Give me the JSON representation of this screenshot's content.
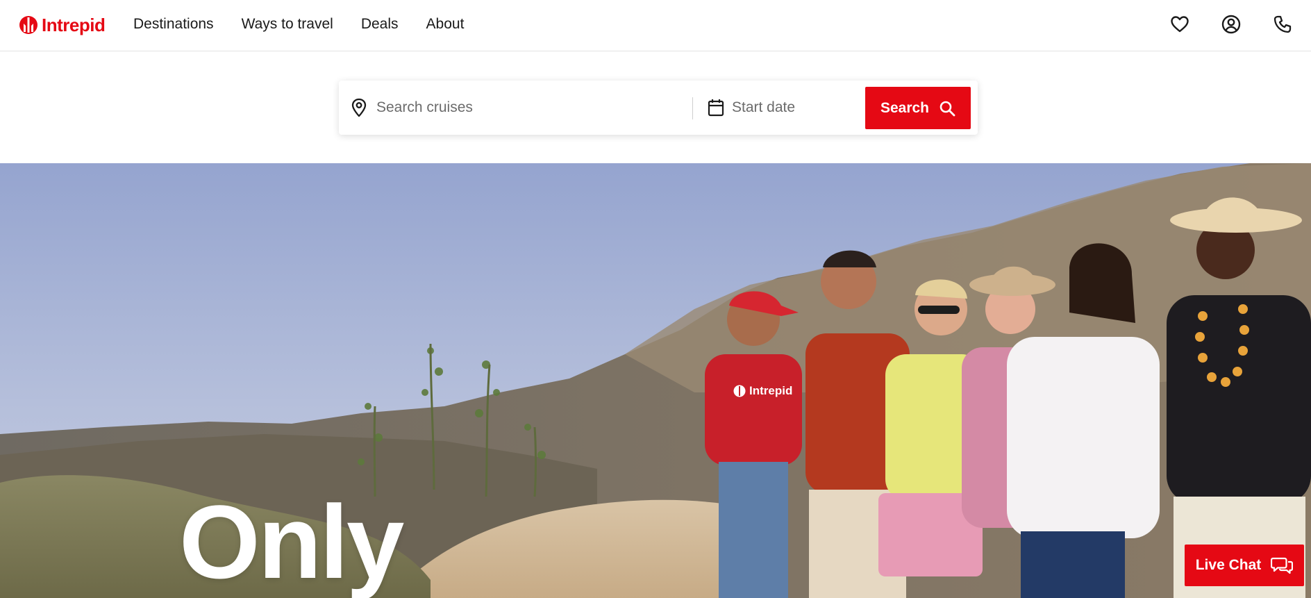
{
  "brand": {
    "name": "Intrepid",
    "color": "#e50914"
  },
  "nav": {
    "items": [
      {
        "label": "Destinations"
      },
      {
        "label": "Ways to travel"
      },
      {
        "label": "Deals"
      },
      {
        "label": "About"
      }
    ]
  },
  "header_icons": [
    "heart-icon",
    "account-icon",
    "phone-icon"
  ],
  "search": {
    "destination_placeholder": "Search cruises",
    "date_placeholder": "Start date",
    "button_label": "Search"
  },
  "hero": {
    "heading": "Only",
    "tshirt_logo_text": "Intrepid"
  },
  "live_chat": {
    "label": "Live Chat"
  }
}
